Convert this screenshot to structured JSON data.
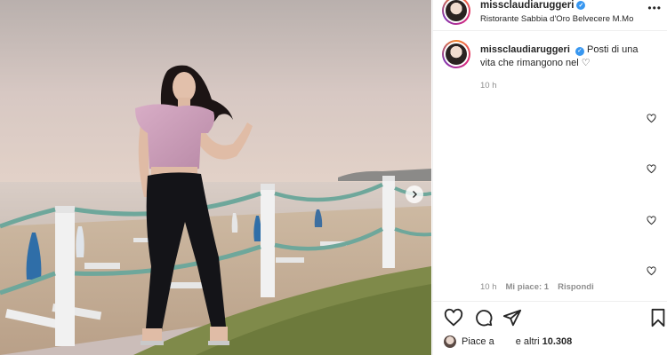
{
  "post": {
    "author": "missclaudiaruggeri",
    "location": "Ristorante Sabbia d'Oro Belvecere M.Mo",
    "caption_text": "Posti di una vita che rimangono nel ♡",
    "caption_time": "10 h"
  },
  "comment_meta": {
    "time": "10 h",
    "likes": "Mi piace: 1",
    "reply": "Rispondi"
  },
  "likes_line": {
    "prefix": "Piace a",
    "suffix": "e altri",
    "count": "10.308"
  },
  "icons": {
    "verified": "verified-badge-icon",
    "more": "more-options-icon",
    "like": "heart-icon",
    "comment": "comment-icon",
    "share": "send-icon",
    "save": "bookmark-icon",
    "next": "chevron-right-icon"
  },
  "colors": {
    "verified": "#3897f0",
    "muted_text": "#8e8e8e",
    "primary_text": "#262626"
  }
}
